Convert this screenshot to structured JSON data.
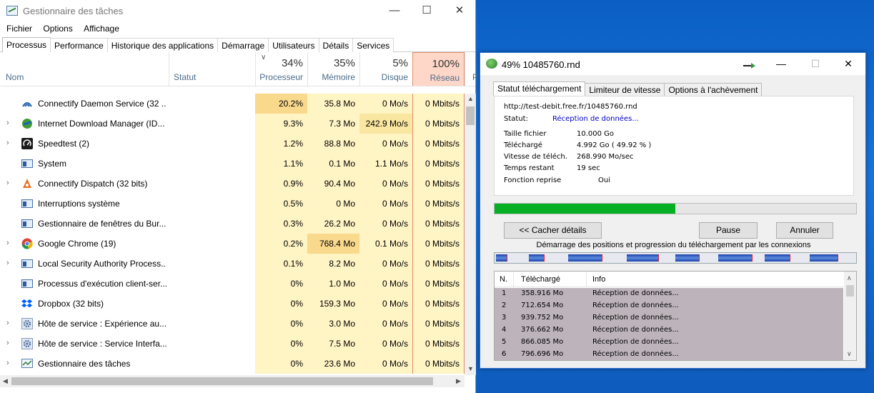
{
  "task_manager": {
    "title": "Gestionnaire des tâches",
    "menu": [
      "Fichier",
      "Options",
      "Affichage"
    ],
    "tabs": [
      "Processus",
      "Performance",
      "Historique des applications",
      "Démarrage",
      "Utilisateurs",
      "Détails",
      "Services"
    ],
    "columns": {
      "name": "Nom",
      "status": "Statut",
      "cpu": {
        "pct": "34%",
        "label": "Processeur"
      },
      "mem": {
        "pct": "35%",
        "label": "Mémoire"
      },
      "disk": {
        "pct": "5%",
        "label": "Disque"
      },
      "net": {
        "pct": "100%",
        "label": "Réseau"
      },
      "more": "P"
    },
    "rows": [
      {
        "name": "Connectify Daemon Service (32 ...",
        "cpu": "20.2%",
        "mem": "35.8 Mo",
        "disk": "0 Mo/s",
        "net": "0 Mbits/s",
        "icon": "connectify-icon",
        "expand": false
      },
      {
        "name": "Internet Download Manager (ID...",
        "cpu": "9.3%",
        "mem": "7.3 Mo",
        "disk": "242.9 Mo/s",
        "net": "0 Mbits/s",
        "icon": "idm-icon",
        "expand": true
      },
      {
        "name": "Speedtest (2)",
        "cpu": "1.2%",
        "mem": "88.8 Mo",
        "disk": "0 Mo/s",
        "net": "0 Mbits/s",
        "icon": "speedtest-icon",
        "expand": true
      },
      {
        "name": "System",
        "cpu": "1.1%",
        "mem": "0.1 Mo",
        "disk": "1.1 Mo/s",
        "net": "0 Mbits/s",
        "icon": "system-icon",
        "expand": false
      },
      {
        "name": "Connectify Dispatch (32 bits)",
        "cpu": "0.9%",
        "mem": "90.4 Mo",
        "disk": "0 Mo/s",
        "net": "0 Mbits/s",
        "icon": "connectify-dispatch-icon",
        "expand": true
      },
      {
        "name": "Interruptions système",
        "cpu": "0.5%",
        "mem": "0 Mo",
        "disk": "0 Mo/s",
        "net": "0 Mbits/s",
        "icon": "system-icon",
        "expand": false
      },
      {
        "name": "Gestionnaire de fenêtres du Bur...",
        "cpu": "0.3%",
        "mem": "26.2 Mo",
        "disk": "0 Mo/s",
        "net": "0 Mbits/s",
        "icon": "window-manager-icon",
        "expand": false
      },
      {
        "name": "Google Chrome (19)",
        "cpu": "0.2%",
        "mem": "768.4 Mo",
        "disk": "0.1 Mo/s",
        "net": "0 Mbits/s",
        "icon": "chrome-icon",
        "expand": true
      },
      {
        "name": "Local Security Authority Process...",
        "cpu": "0.1%",
        "mem": "8.2 Mo",
        "disk": "0 Mo/s",
        "net": "0 Mbits/s",
        "icon": "system-icon",
        "expand": true
      },
      {
        "name": "Processus d'exécution client-ser...",
        "cpu": "0%",
        "mem": "1.0 Mo",
        "disk": "0 Mo/s",
        "net": "0 Mbits/s",
        "icon": "system-icon",
        "expand": false
      },
      {
        "name": "Dropbox (32 bits)",
        "cpu": "0%",
        "mem": "159.3 Mo",
        "disk": "0 Mo/s",
        "net": "0 Mbits/s",
        "icon": "dropbox-icon",
        "expand": false
      },
      {
        "name": "Hôte de service : Expérience au...",
        "cpu": "0%",
        "mem": "3.0 Mo",
        "disk": "0 Mo/s",
        "net": "0 Mbits/s",
        "icon": "gear-icon",
        "expand": true
      },
      {
        "name": "Hôte de service : Service Interfa...",
        "cpu": "0%",
        "mem": "7.5 Mo",
        "disk": "0 Mo/s",
        "net": "0 Mbits/s",
        "icon": "gear-icon",
        "expand": true
      },
      {
        "name": "Gestionnaire des tâches",
        "cpu": "0%",
        "mem": "23.6 Mo",
        "disk": "0 Mo/s",
        "net": "0 Mbits/s",
        "icon": "task-manager-icon",
        "expand": true
      }
    ],
    "colors": {
      "cpu_hot": "#f9d98c",
      "cell": "#fff4c4",
      "net_header": "#ffd7c9",
      "net_border": "#e28f6b"
    }
  },
  "idm": {
    "title": "49% 10485760.rnd",
    "tabs": [
      "Statut téléchargement",
      "Limiteur de vitesse",
      "Options à l'achèvement"
    ],
    "url": "http://test-debit.free.fr/10485760.rnd",
    "status_label": "Statut:",
    "status_value": "Réception de données...",
    "fields": [
      {
        "label": "Taille fichier",
        "value": "10.000  Go"
      },
      {
        "label": "Téléchargé",
        "value": "4.992  Go  ( 49.92 % )"
      },
      {
        "label": "Vitesse de téléch.",
        "value": "268.990  Mo/sec"
      },
      {
        "label": "Temps restant",
        "value": "19 sec"
      },
      {
        "label": "Fonction reprise",
        "value": "Oui"
      }
    ],
    "progress": 0.4992,
    "buttons": {
      "hide": "<< Cacher détails",
      "pause": "Pause",
      "cancel": "Annuler"
    },
    "connections_label": "Démarrage des positions et progression du téléchargement par les connexions",
    "list_headers": [
      "N.",
      "Téléchargé",
      "Info"
    ],
    "connections": [
      {
        "n": "1",
        "downloaded": "358.916  Mo",
        "info": "Réception de données..."
      },
      {
        "n": "2",
        "downloaded": "712.654  Mo",
        "info": "Réception de données..."
      },
      {
        "n": "3",
        "downloaded": "939.752  Mo",
        "info": "Réception de données..."
      },
      {
        "n": "4",
        "downloaded": "376.662  Mo",
        "info": "Réception de données..."
      },
      {
        "n": "5",
        "downloaded": "866.085  Mo",
        "info": "Réception de données..."
      },
      {
        "n": "6",
        "downloaded": "796.696  Mo",
        "info": "Réception de données..."
      }
    ],
    "colors": {
      "progress": "#06b025",
      "list_bg": "#bdb4bb",
      "status_blue": "#0000c8"
    }
  }
}
